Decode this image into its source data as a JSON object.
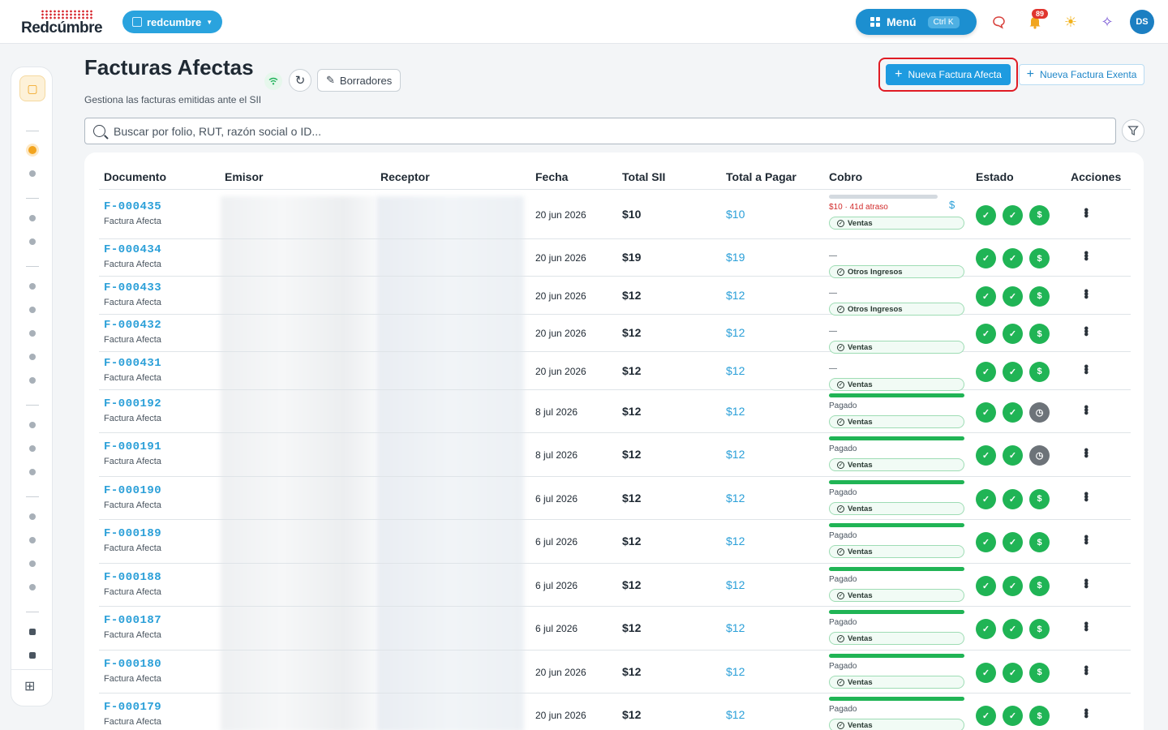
{
  "app": {
    "logo_text": "Redcúmbre",
    "org_name": "redcumbre",
    "menu_label": "Menú",
    "menu_shortcut": "Ctrl K",
    "notification_count": "89",
    "user_initials": "DS"
  },
  "icons": {
    "chat": "chat-bubble-icon",
    "bell": "bell-icon",
    "theme": "sun-icon",
    "ai": "sparkle-icon",
    "wifi": "wifi-icon",
    "refresh": "refresh-icon",
    "filter": "filter-icon"
  },
  "header": {
    "title": "Facturas Afectas",
    "subtitle": "Gestiona las facturas emitidas ante el SII",
    "drafts_label": "Borradores",
    "new_afecta_label": "Nueva Factura Afecta",
    "new_exenta_label": "Nueva Factura Exenta"
  },
  "search": {
    "placeholder": "Buscar por folio, RUT, razón social o ID..."
  },
  "table": {
    "columns": [
      "Documento",
      "Emisor",
      "Receptor",
      "Fecha",
      "Total SII",
      "Total a Pagar",
      "Cobro",
      "Estado",
      "Acciones"
    ],
    "rows": [
      {
        "folio": "F-000435",
        "type": "Factura Afecta",
        "fecha": "20 jun 2026",
        "total": "$10",
        "pagar": "$10",
        "cobro_status": "$10 · 41d atraso",
        "cobro_kind": "overdue",
        "category": "Ventas",
        "estado": [
          "check",
          "check",
          "dollar"
        ]
      },
      {
        "folio": "F-000434",
        "type": "Factura Afecta",
        "fecha": "20 jun 2026",
        "total": "$19",
        "pagar": "$19",
        "cobro_status": "—",
        "cobro_kind": "none",
        "category": "Otros Ingresos",
        "estado": [
          "check",
          "check",
          "dollar"
        ]
      },
      {
        "folio": "F-000433",
        "type": "Factura Afecta",
        "fecha": "20 jun 2026",
        "total": "$12",
        "pagar": "$12",
        "cobro_status": "—",
        "cobro_kind": "none",
        "category": "Otros Ingresos",
        "estado": [
          "check",
          "check",
          "dollar"
        ]
      },
      {
        "folio": "F-000432",
        "type": "Factura Afecta",
        "fecha": "20 jun 2026",
        "total": "$12",
        "pagar": "$12",
        "cobro_status": "—",
        "cobro_kind": "none",
        "category": "Ventas",
        "estado": [
          "check",
          "check",
          "dollar"
        ]
      },
      {
        "folio": "F-000431",
        "type": "Factura Afecta",
        "fecha": "20 jun 2026",
        "total": "$12",
        "pagar": "$12",
        "cobro_status": "—",
        "cobro_kind": "none",
        "category": "Ventas",
        "estado": [
          "check",
          "check",
          "dollar"
        ]
      },
      {
        "folio": "F-000192",
        "type": "Factura Afecta",
        "fecha": "8 jul 2026",
        "total": "$12",
        "pagar": "$12",
        "cobro_status": "Pagado",
        "cobro_kind": "paid",
        "category": "Ventas",
        "estado": [
          "check",
          "check",
          "clock"
        ]
      },
      {
        "folio": "F-000191",
        "type": "Factura Afecta",
        "fecha": "8 jul 2026",
        "total": "$12",
        "pagar": "$12",
        "cobro_status": "Pagado",
        "cobro_kind": "paid",
        "category": "Ventas",
        "estado": [
          "check",
          "check",
          "clock"
        ]
      },
      {
        "folio": "F-000190",
        "type": "Factura Afecta",
        "fecha": "6 jul 2026",
        "total": "$12",
        "pagar": "$12",
        "cobro_status": "Pagado",
        "cobro_kind": "paid",
        "category": "Ventas",
        "estado": [
          "check",
          "check",
          "dollar"
        ]
      },
      {
        "folio": "F-000189",
        "type": "Factura Afecta",
        "fecha": "6 jul 2026",
        "total": "$12",
        "pagar": "$12",
        "cobro_status": "Pagado",
        "cobro_kind": "paid",
        "category": "Ventas",
        "estado": [
          "check",
          "check",
          "dollar"
        ]
      },
      {
        "folio": "F-000188",
        "type": "Factura Afecta",
        "fecha": "6 jul 2026",
        "total": "$12",
        "pagar": "$12",
        "cobro_status": "Pagado",
        "cobro_kind": "paid",
        "category": "Ventas",
        "estado": [
          "check",
          "check",
          "dollar"
        ]
      },
      {
        "folio": "F-000187",
        "type": "Factura Afecta",
        "fecha": "6 jul 2026",
        "total": "$12",
        "pagar": "$12",
        "cobro_status": "Pagado",
        "cobro_kind": "paid",
        "category": "Ventas",
        "estado": [
          "check",
          "check",
          "dollar"
        ]
      },
      {
        "folio": "F-000180",
        "type": "Factura Afecta",
        "fecha": "20 jun 2026",
        "total": "$12",
        "pagar": "$12",
        "cobro_status": "Pagado",
        "cobro_kind": "paid",
        "category": "Ventas",
        "estado": [
          "check",
          "check",
          "dollar"
        ]
      },
      {
        "folio": "F-000179",
        "type": "Factura Afecta",
        "fecha": "20 jun 2026",
        "total": "$12",
        "pagar": "$12",
        "cobro_status": "Pagado",
        "cobro_kind": "paid",
        "category": "Ventas",
        "estado": [
          "check",
          "check",
          "dollar"
        ]
      }
    ]
  },
  "colors": {
    "accent": "#1e9be0",
    "success": "#20b455",
    "danger": "#d12b2b",
    "highlight_border": "#e01b24"
  }
}
